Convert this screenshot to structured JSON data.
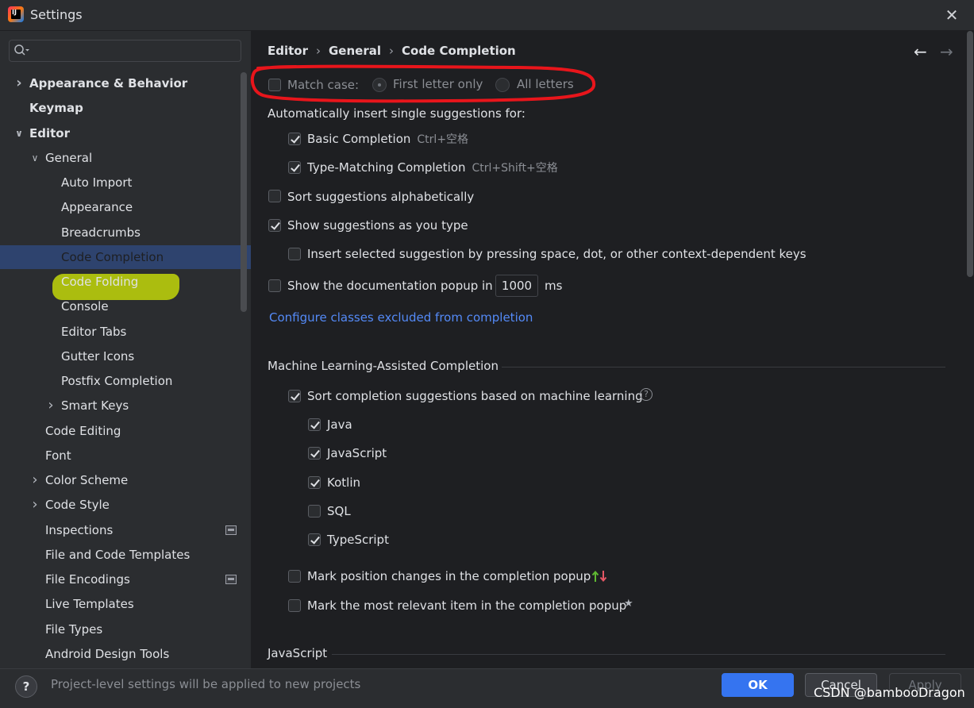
{
  "window": {
    "title": "Settings",
    "app_icon_text": "IJ"
  },
  "sidebar": {
    "search_placeholder": "",
    "tree": [
      {
        "label": "Appearance & Behavior",
        "bold": true,
        "expander": "collapsed"
      },
      {
        "label": "Keymap",
        "bold": true,
        "expander": "none"
      },
      {
        "label": "Editor",
        "bold": true,
        "expander": "expanded"
      },
      {
        "label": "General",
        "bold": false,
        "expander": "expanded"
      },
      {
        "label": "Auto Import"
      },
      {
        "label": "Appearance"
      },
      {
        "label": "Breadcrumbs"
      },
      {
        "label": "Code Completion",
        "selected": true
      },
      {
        "label": "Code Folding"
      },
      {
        "label": "Console"
      },
      {
        "label": "Editor Tabs"
      },
      {
        "label": "Gutter Icons"
      },
      {
        "label": "Postfix Completion"
      },
      {
        "label": "Smart Keys",
        "expander": "collapsed"
      },
      {
        "label": "Code Editing"
      },
      {
        "label": "Font"
      },
      {
        "label": "Color Scheme",
        "expander": "collapsed"
      },
      {
        "label": "Code Style",
        "expander": "collapsed"
      },
      {
        "label": "Inspections",
        "project_icon": true
      },
      {
        "label": "File and Code Templates"
      },
      {
        "label": "File Encodings",
        "project_icon": true
      },
      {
        "label": "Live Templates"
      },
      {
        "label": "File Types"
      },
      {
        "label": "Android Design Tools"
      }
    ]
  },
  "breadcrumb": [
    "Editor",
    "General",
    "Code Completion"
  ],
  "breadcrumb_sep": "›",
  "nav": {
    "back_icon": "arrow-left-icon",
    "forward_icon": "arrow-right-icon"
  },
  "match_case": {
    "label": "Match case:",
    "checked": false,
    "options": [
      {
        "label": "First letter only",
        "selected": true
      },
      {
        "label": "All letters",
        "selected": false
      }
    ]
  },
  "auto_insert": {
    "label": "Automatically insert single suggestions for:",
    "items": [
      {
        "label": "Basic Completion",
        "shortcut": "Ctrl+空格",
        "checked": true
      },
      {
        "label": "Type-Matching Completion",
        "shortcut": "Ctrl+Shift+空格",
        "checked": true
      }
    ]
  },
  "sort_alpha": {
    "label": "Sort suggestions alphabetically",
    "checked": false
  },
  "show_as_type": {
    "label": "Show suggestions as you type",
    "checked": true
  },
  "insert_selected": {
    "label": "Insert selected suggestion by pressing space, dot, or other context-dependent keys",
    "checked": false
  },
  "doc_popup": {
    "label": "Show the documentation popup in",
    "value": "1000",
    "unit": "ms",
    "checked": false
  },
  "exclude_link": "Configure classes excluded from completion",
  "ml_section": {
    "title": "Machine Learning-Assisted Completion",
    "sort_ml": {
      "label": "Sort completion suggestions based on machine learning",
      "checked": true
    },
    "languages": [
      {
        "label": "Java",
        "checked": true
      },
      {
        "label": "JavaScript",
        "checked": true
      },
      {
        "label": "Kotlin",
        "checked": true
      },
      {
        "label": "SQL",
        "checked": false
      },
      {
        "label": "TypeScript",
        "checked": true
      }
    ],
    "mark_position": {
      "label": "Mark position changes in the completion popup",
      "checked": false
    },
    "mark_relevant": {
      "label": "Mark the most relevant item in the completion popup",
      "checked": false
    }
  },
  "js_section": {
    "title": "JavaScript"
  },
  "footer": {
    "note": "Project-level settings will be applied to new projects",
    "help_label": "?",
    "ok": "OK",
    "cancel": "Cancel",
    "apply": "Apply",
    "watermark": "CSDN @bambooDragon"
  },
  "colors": {
    "accent": "#3574f0",
    "link": "#548af7",
    "selection": "#2e436e",
    "annotation_red": "#e8151b",
    "annotation_green": "#b2c50e"
  }
}
